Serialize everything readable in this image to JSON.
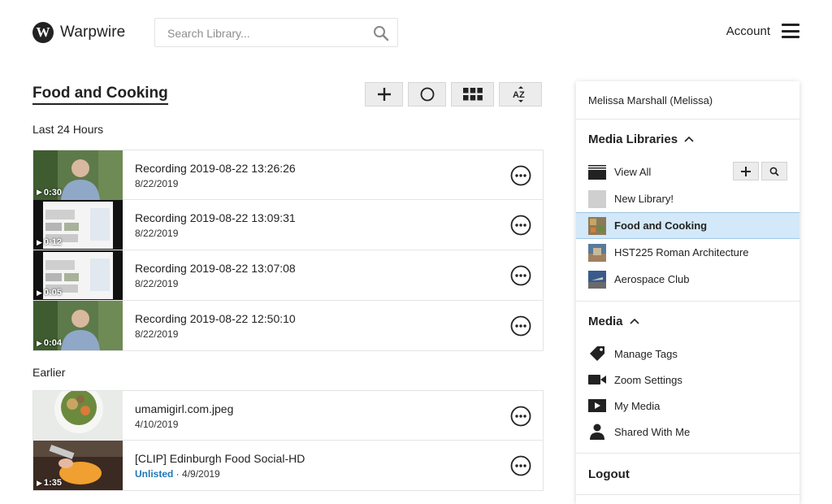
{
  "header": {
    "logo_letter": "W",
    "logo_text": "Warpwire",
    "search_placeholder": "Search Library...",
    "account_label": "Account"
  },
  "main": {
    "title": "Food and Cooking",
    "sections": [
      {
        "label": "Last 24 Hours",
        "items": [
          {
            "title": "Recording 2019-08-22 13:26:26",
            "date": "8/22/2019",
            "duration": "0:30",
            "thumb": "person"
          },
          {
            "title": "Recording 2019-08-22 13:09:31",
            "date": "8/22/2019",
            "duration": "0:12",
            "thumb": "screen"
          },
          {
            "title": "Recording 2019-08-22 13:07:08",
            "date": "8/22/2019",
            "duration": "0:05",
            "thumb": "screen"
          },
          {
            "title": "Recording 2019-08-22 12:50:10",
            "date": "8/22/2019",
            "duration": "0:04",
            "thumb": "person"
          }
        ]
      },
      {
        "label": "Earlier",
        "items": [
          {
            "title": "umamigirl.com.jpeg",
            "date": "4/10/2019",
            "duration": "",
            "thumb": "food"
          },
          {
            "title": "[CLIP] Edinburgh Food Social-HD",
            "status": "Unlisted",
            "separator": " · ",
            "date": "4/9/2019",
            "duration": "1:35",
            "thumb": "cooking"
          }
        ]
      }
    ]
  },
  "sidebar": {
    "user": "Melissa Marshall (Melissa)",
    "media_libraries": {
      "heading": "Media Libraries",
      "items": [
        {
          "label": "View All",
          "icon": "folder-stack-icon"
        },
        {
          "label": "New Library!",
          "icon": "blank-library-icon"
        },
        {
          "label": "Food and Cooking",
          "icon": "library-thumb",
          "active": true
        },
        {
          "label": "HST225 Roman Architecture",
          "icon": "library-thumb"
        },
        {
          "label": "Aerospace Club",
          "icon": "library-thumb"
        }
      ]
    },
    "media": {
      "heading": "Media",
      "items": [
        {
          "label": "Manage Tags",
          "icon": "tag-icon"
        },
        {
          "label": "Zoom Settings",
          "icon": "video-camera-icon"
        },
        {
          "label": "My Media",
          "icon": "play-box-icon"
        },
        {
          "label": "Shared With Me",
          "icon": "person-icon"
        }
      ]
    },
    "logout": "Logout"
  },
  "colors": {
    "accent": "#1f77b4",
    "active_bg": "#d3e8f8"
  }
}
